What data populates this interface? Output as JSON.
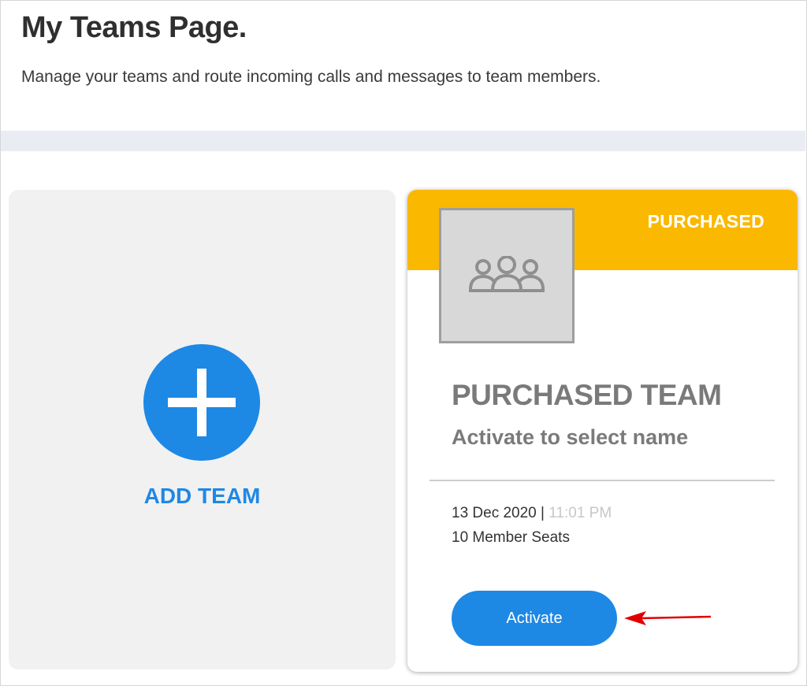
{
  "page": {
    "title": "My Teams Page.",
    "subtitle": "Manage your teams and route incoming calls and messages to team members."
  },
  "add_team": {
    "label": "ADD TEAM",
    "icon": "plus-icon"
  },
  "team_card": {
    "status": "PURCHASED",
    "avatar_icon": "team-group-icon",
    "name": "PURCHASED TEAM",
    "hint": "Activate to select name",
    "date": "13 Dec 2020",
    "separator": " | ",
    "time": "11:01 PM",
    "seats": "10 Member Seats",
    "activate_label": "Activate"
  },
  "colors": {
    "accent": "#1e88e5",
    "banner": "#fbb800",
    "annotation_arrow": "#e00000"
  }
}
